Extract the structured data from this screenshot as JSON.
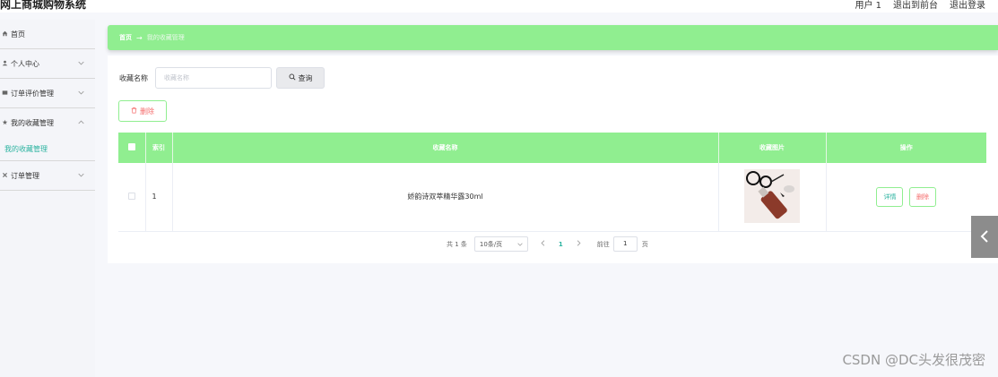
{
  "header": {
    "app_title": "网上商城购物系统",
    "user_label": "用户 1",
    "back_to_front": "退出到前台",
    "logout": "退出登录"
  },
  "sidebar": {
    "items": [
      {
        "label": "首页",
        "icon": "home-icon"
      },
      {
        "label": "个人中心",
        "icon": "user-icon"
      },
      {
        "label": "订单评价管理",
        "icon": "comment-icon"
      },
      {
        "label": "我的收藏管理",
        "icon": "star-icon"
      },
      {
        "label": "订单管理",
        "icon": "order-icon"
      }
    ],
    "active_sub": "我的收藏管理"
  },
  "breadcrumb": {
    "home": "首页",
    "current": "我的收藏管理"
  },
  "search": {
    "label": "收藏名称",
    "placeholder": "收藏名称",
    "button": "查询"
  },
  "actions": {
    "delete": "删除"
  },
  "table": {
    "headers": [
      "索引",
      "收藏名称",
      "收藏图片",
      "操作"
    ],
    "rows": [
      {
        "index": "1",
        "name": "娇韵诗双萃精华露30ml",
        "detail": "详情",
        "remove": "删除"
      }
    ]
  },
  "pagination": {
    "total": "共 1 条",
    "page_size": "10条/页",
    "current_page": "1",
    "goto_label": "前往",
    "goto_value": "1",
    "page_unit": "页"
  },
  "watermark": "CSDN @DC头发很茂密",
  "colors": {
    "accent_green": "#90ee90",
    "link_teal": "#2bb3a0",
    "danger_red": "#f56c6c"
  }
}
